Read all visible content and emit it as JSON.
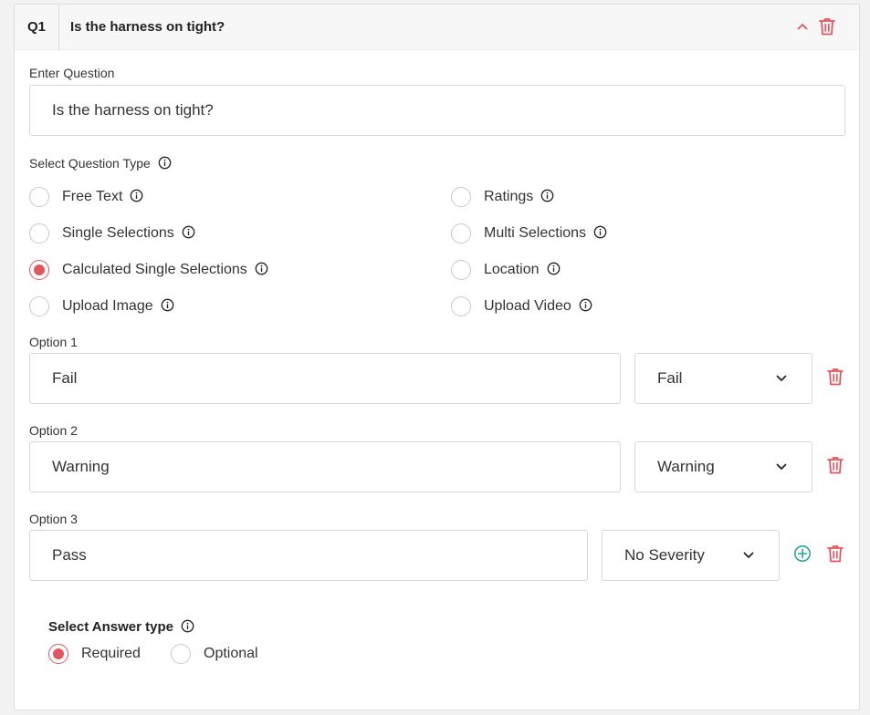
{
  "question": {
    "number": "Q1",
    "title": "Is the harness on tight?"
  },
  "enter_question": {
    "label": "Enter Question",
    "value": "Is the harness on tight?"
  },
  "question_type": {
    "label": "Select Question Type",
    "options": [
      {
        "label": "Free Text",
        "checked": false
      },
      {
        "label": "Ratings",
        "checked": false
      },
      {
        "label": "Single Selections",
        "checked": false
      },
      {
        "label": "Multi Selections",
        "checked": false
      },
      {
        "label": "Calculated Single Selections",
        "checked": true
      },
      {
        "label": "Location",
        "checked": false
      },
      {
        "label": "Upload Image",
        "checked": false
      },
      {
        "label": "Upload Video",
        "checked": false
      }
    ]
  },
  "options": [
    {
      "label": "Option 1",
      "value": "Fail",
      "severity": "Fail"
    },
    {
      "label": "Option 2",
      "value": "Warning",
      "severity": "Warning"
    },
    {
      "label": "Option 3",
      "value": "Pass",
      "severity": "No Severity"
    }
  ],
  "answer_type": {
    "label": "Select Answer type",
    "options": [
      {
        "label": "Required",
        "checked": true
      },
      {
        "label": "Optional",
        "checked": false
      }
    ]
  },
  "colors": {
    "accent": "#e5555f",
    "add": "#2aa39a"
  },
  "icons": {
    "collapse": "chevron-up-icon",
    "delete": "trash-icon",
    "info": "info-icon",
    "dropdown": "chevron-down-icon",
    "add": "plus-circle-icon"
  }
}
